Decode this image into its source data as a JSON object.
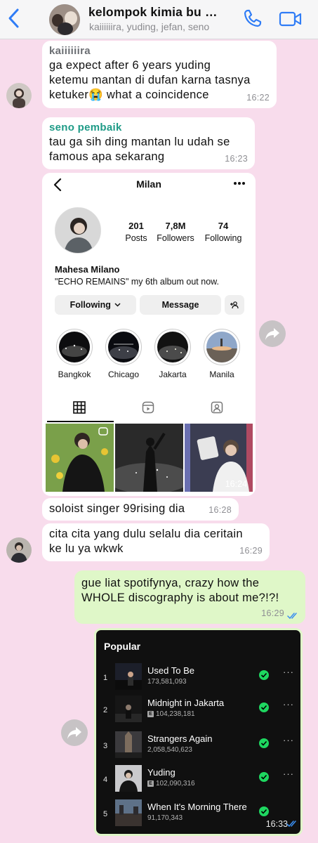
{
  "header": {
    "title": "kelompok kimia bu …",
    "subtitle": "kaiiiiiira, yuding, jefan, seno",
    "back_icon": "chevron-left-icon",
    "call_icon": "phone-icon",
    "video_icon": "video-camera-icon",
    "accent": "#2f7cf6"
  },
  "messages": [
    {
      "sender": "kaiiiiiira",
      "lines": [
        "ga expect after 6 years yuding",
        "ketemu mantan di dufan karna tasnya",
        "ketuker😭 what a coincidence"
      ],
      "time": "16:22",
      "sender_color": "#6b6e73"
    },
    {
      "sender": "seno pembaik",
      "lines": [
        "tau ga sih ding mantan lu udah se",
        "famous apa sekarang"
      ],
      "time": "16:23",
      "sender_color": "#1e9b87"
    },
    {
      "text": "soloist singer 99rising dia",
      "time": "16:28"
    },
    {
      "lines": [
        "cita cita yang dulu selalu dia ceritain",
        "ke lu ya wkwk"
      ],
      "time": "16:29"
    },
    {
      "lines": [
        "gue liat spotifynya, crazy how the",
        "WHOLE discography is about me?!?!"
      ],
      "time": "16:29",
      "outgoing": true
    }
  ],
  "instagram": {
    "username": "Milan",
    "posts": "201",
    "posts_label": "Posts",
    "followers": "7,8M",
    "followers_label": "Followers",
    "following": "74",
    "following_label": "Following",
    "full_name": "Mahesa Milano",
    "bio": "\"ECHO REMAINS\" my 6th album out now.",
    "btn_following": "Following",
    "btn_message": "Message",
    "highlights": [
      "Bangkok",
      "Chicago",
      "Jakarta",
      "Manila"
    ],
    "time": "16:24"
  },
  "spotify": {
    "section_title": "Popular",
    "tracks": [
      {
        "num": "1",
        "name": "Used To Be",
        "plays": "173,581,093",
        "explicit": false
      },
      {
        "num": "2",
        "name": "Midnight in Jakarta",
        "plays": "104,238,181",
        "explicit": true
      },
      {
        "num": "3",
        "name": "Strangers Again",
        "plays": "2,058,540,623",
        "explicit": false
      },
      {
        "num": "4",
        "name": "Yuding",
        "plays": "102,090,316",
        "explicit": true
      },
      {
        "num": "5",
        "name": "When It's Morning There",
        "plays": "91,170,343",
        "explicit": false
      }
    ],
    "explicit_badge": "E",
    "more_glyph": "···",
    "time": "16:33"
  }
}
